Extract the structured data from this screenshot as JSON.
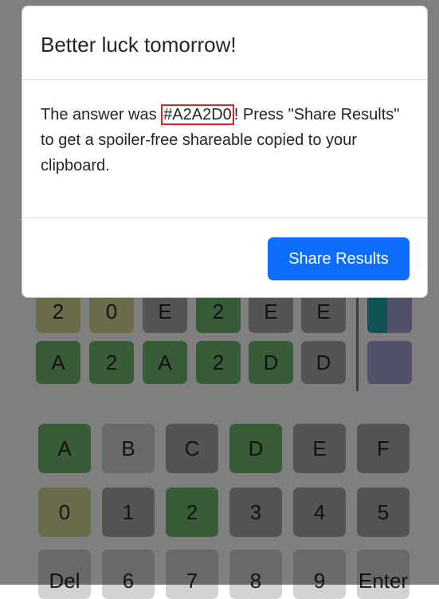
{
  "board": {
    "rows": [
      [
        {
          "ch": "2",
          "state": "yellow"
        },
        {
          "ch": "0",
          "state": "yellow"
        },
        {
          "ch": "E",
          "state": "gray"
        },
        {
          "ch": "2",
          "state": "green"
        },
        {
          "ch": "E",
          "state": "gray"
        },
        {
          "ch": "E",
          "state": "gray"
        }
      ],
      [
        {
          "ch": "A",
          "state": "green"
        },
        {
          "ch": "2",
          "state": "green"
        },
        {
          "ch": "A",
          "state": "green"
        },
        {
          "ch": "2",
          "state": "green"
        },
        {
          "ch": "D",
          "state": "green"
        },
        {
          "ch": "D",
          "state": "gray"
        }
      ]
    ],
    "guess_colors": [
      "#20a6a6 / #a0a0d0",
      "#a2a2d0"
    ]
  },
  "keyboard": {
    "rows": [
      [
        {
          "label": "A",
          "state": "green"
        },
        {
          "label": "B",
          "state": "light"
        },
        {
          "label": "C",
          "state": "gray"
        },
        {
          "label": "D",
          "state": "green"
        },
        {
          "label": "E",
          "state": "gray"
        },
        {
          "label": "F",
          "state": "gray"
        }
      ],
      [
        {
          "label": "0",
          "state": "yellow"
        },
        {
          "label": "1",
          "state": "gray"
        },
        {
          "label": "2",
          "state": "green"
        },
        {
          "label": "3",
          "state": "gray"
        },
        {
          "label": "4",
          "state": "gray"
        },
        {
          "label": "5",
          "state": "gray"
        }
      ],
      [
        {
          "label": "Del",
          "state": "light"
        },
        {
          "label": "6",
          "state": "light"
        },
        {
          "label": "7",
          "state": "light"
        },
        {
          "label": "8",
          "state": "light"
        },
        {
          "label": "9",
          "state": "light"
        },
        {
          "label": "Enter",
          "state": "light"
        }
      ]
    ]
  },
  "modal": {
    "title": "Better luck tomorrow!",
    "body_prefix": "The answer was ",
    "answer": "#A2A2D0",
    "body_suffix": "! Press \"Share Results\" to get a spoiler-free shareable copied to your clipboard.",
    "share_label": "Share Results"
  },
  "colors": {
    "accent": "#0d6efd",
    "green": "#6fb96f",
    "yellow": "#d9d99a",
    "gray": "#a8a8a8",
    "answer_border": "#e02020"
  }
}
